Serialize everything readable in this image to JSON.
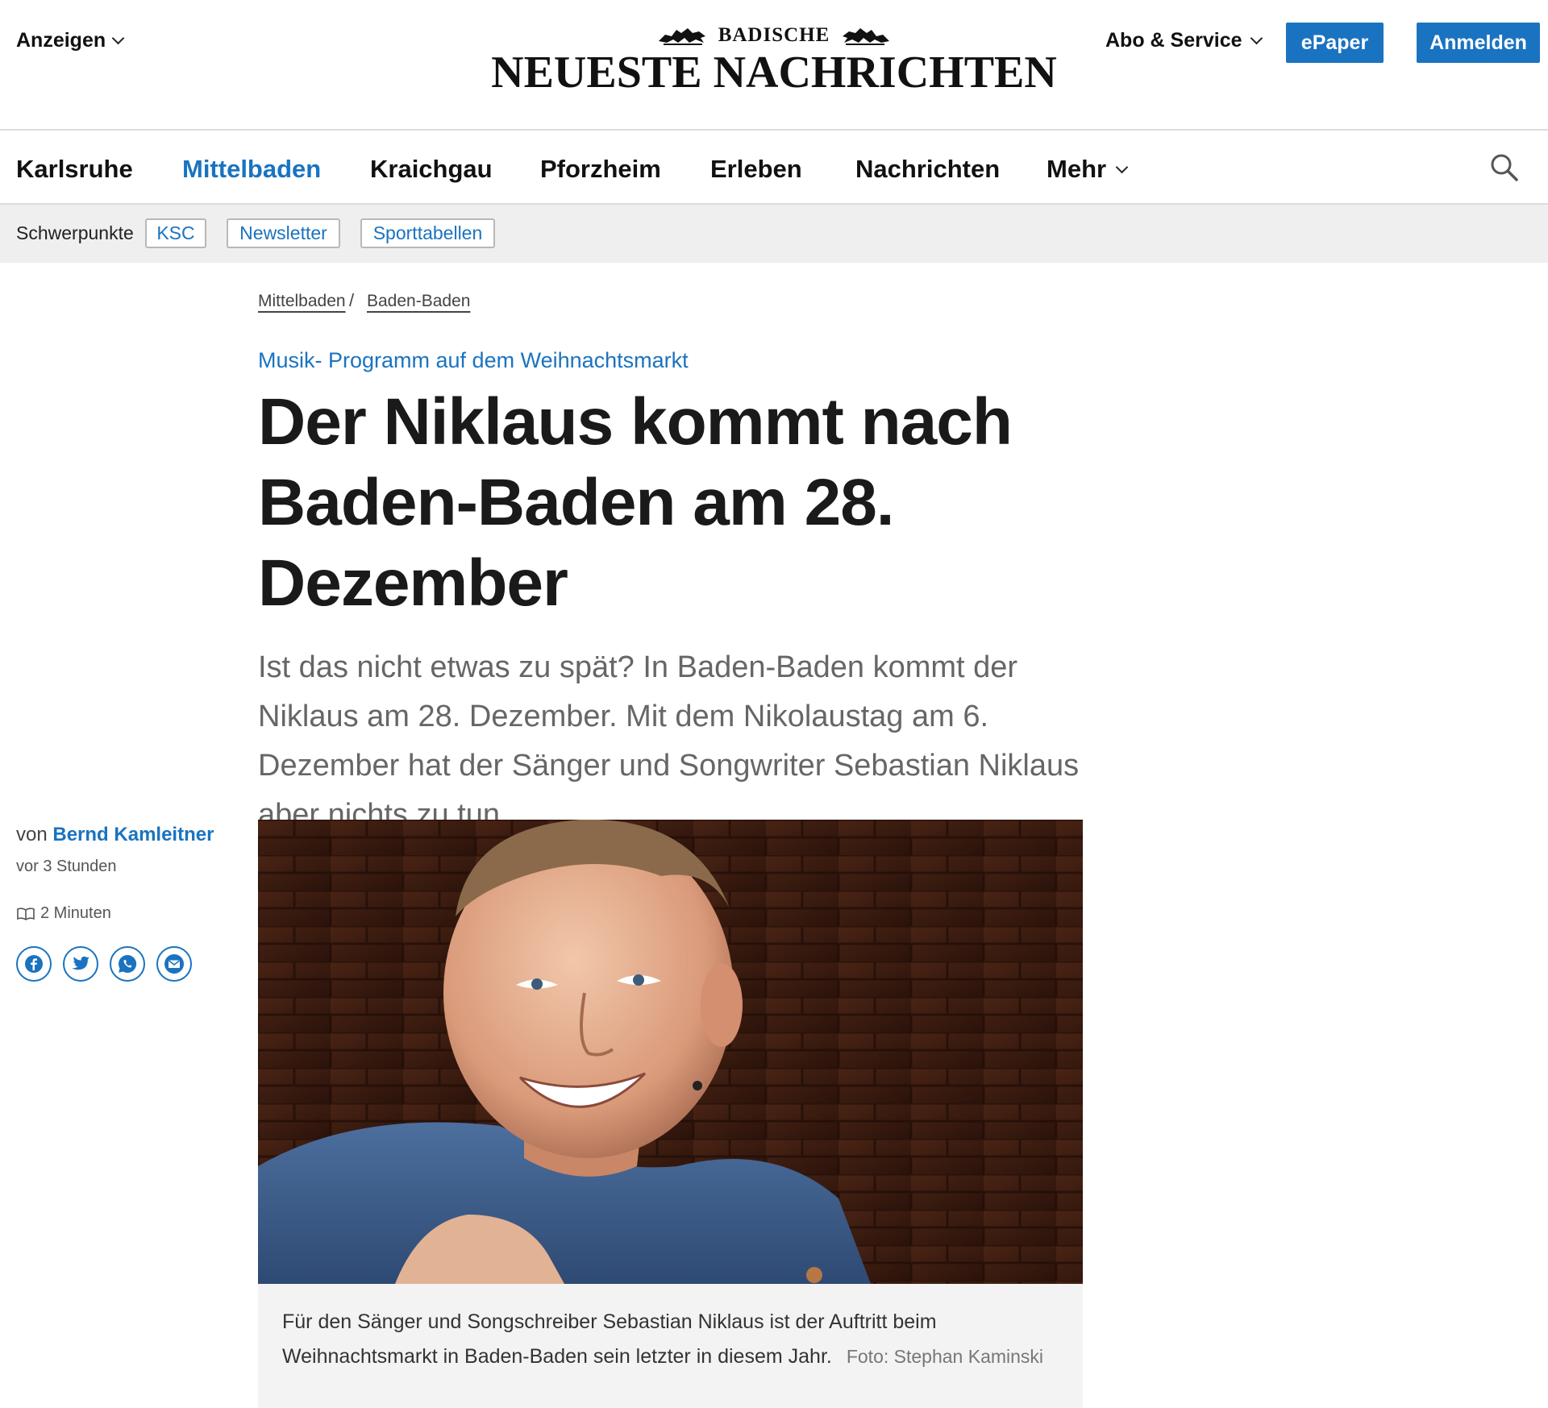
{
  "header": {
    "anzeigen_label": "Anzeigen",
    "logo_top": "BADISCHE",
    "logo_main": "NEUESTE NACHRICHTEN",
    "abo_label": "Abo & Service",
    "epaper_label": "ePaper",
    "login_label": "Anmelden"
  },
  "nav": {
    "items": [
      {
        "label": "Karlsruhe"
      },
      {
        "label": "Mittelbaden",
        "active": true
      },
      {
        "label": "Kraichgau"
      },
      {
        "label": "Pforzheim"
      },
      {
        "label": "Erleben"
      },
      {
        "label": "Nachrichten"
      },
      {
        "label": "Mehr"
      }
    ],
    "search_icon": "search-icon"
  },
  "schwerpunkte": {
    "label": "Schwerpunkte",
    "chips": [
      "KSC",
      "Newsletter",
      "Sporttabellen"
    ]
  },
  "breadcrumb": [
    "Mittelbaden",
    "Baden-Baden"
  ],
  "breadcrumb_separator": "/",
  "article": {
    "kicker": "Musik- Programm auf dem Weihnachtsmarkt",
    "headline": "Der Niklaus kommt nach Baden-Baden am 28. Dezember",
    "lead": "Ist das nicht etwas zu spät? In Baden-Baden kommt der Niklaus am 28. Dezember. Mit dem Nikolaustag am 6. Dezember hat der Sänger und Songwriter Sebastian Niklaus aber nichts zu tun.",
    "byline_prefix": "von",
    "author": "Bernd Kamleitner",
    "time_ago": "vor 3 Stunden",
    "reading_time": "2 Minuten",
    "share_icons": [
      "facebook-icon",
      "twitter-icon",
      "whatsapp-icon",
      "email-icon"
    ],
    "image_caption": "Für den Sänger und Songschreiber Sebastian Niklaus ist der Auftritt beim Weihnachtsmarkt in Baden-Baden sein letzter in diesem Jahr.",
    "image_credit": "Foto: Stephan Kaminski"
  },
  "colors": {
    "accent": "#1a73c0",
    "text": "#1a1a1a",
    "lead": "#666666",
    "bar_bg": "#efefef"
  }
}
